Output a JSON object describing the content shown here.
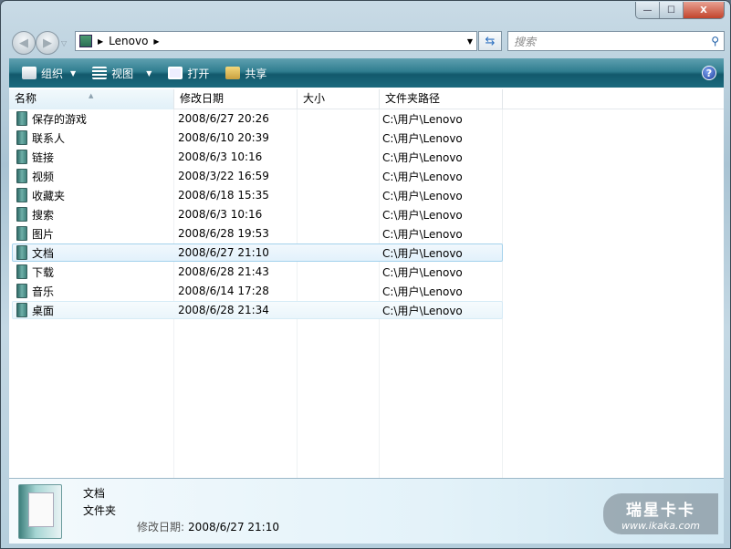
{
  "window": {
    "minimize": "—",
    "maximize": "☐",
    "close": "X"
  },
  "address": {
    "crumbs": [
      "Lenovo"
    ],
    "search_placeholder": "搜索"
  },
  "toolbar": {
    "organize": "组织",
    "views": "视图",
    "open": "打开",
    "share": "共享",
    "help": "?"
  },
  "columns": [
    "名称",
    "修改日期",
    "大小",
    "文件夹路径"
  ],
  "rows": [
    {
      "name": "保存的游戏",
      "date": "2008/6/27 20:26",
      "size": "",
      "path": "C:\\用户\\Lenovo",
      "icon": "saved-games-folder-icon"
    },
    {
      "name": "联系人",
      "date": "2008/6/10 20:39",
      "size": "",
      "path": "C:\\用户\\Lenovo",
      "icon": "contacts-folder-icon"
    },
    {
      "name": "链接",
      "date": "2008/6/3 10:16",
      "size": "",
      "path": "C:\\用户\\Lenovo",
      "icon": "links-folder-icon"
    },
    {
      "name": "视频",
      "date": "2008/3/22 16:59",
      "size": "",
      "path": "C:\\用户\\Lenovo",
      "icon": "videos-folder-icon"
    },
    {
      "name": "收藏夹",
      "date": "2008/6/18 15:35",
      "size": "",
      "path": "C:\\用户\\Lenovo",
      "icon": "favorites-folder-icon"
    },
    {
      "name": "搜索",
      "date": "2008/6/3 10:16",
      "size": "",
      "path": "C:\\用户\\Lenovo",
      "icon": "searches-folder-icon"
    },
    {
      "name": "图片",
      "date": "2008/6/28 19:53",
      "size": "",
      "path": "C:\\用户\\Lenovo",
      "icon": "pictures-folder-icon"
    },
    {
      "name": "文档",
      "date": "2008/6/27 21:10",
      "size": "",
      "path": "C:\\用户\\Lenovo",
      "icon": "documents-folder-icon",
      "state": "sel"
    },
    {
      "name": "下载",
      "date": "2008/6/28 21:43",
      "size": "",
      "path": "C:\\用户\\Lenovo",
      "icon": "downloads-folder-icon"
    },
    {
      "name": "音乐",
      "date": "2008/6/14 17:28",
      "size": "",
      "path": "C:\\用户\\Lenovo",
      "icon": "music-folder-icon"
    },
    {
      "name": "桌面",
      "date": "2008/6/28 21:34",
      "size": "",
      "path": "C:\\用户\\Lenovo",
      "icon": "desktop-folder-icon",
      "state": "hov"
    }
  ],
  "details": {
    "name": "文档",
    "type": "文件夹",
    "modified_label": "修改日期:",
    "modified_value": "2008/6/27 21:10"
  },
  "watermark": {
    "title": "瑞星卡卡",
    "url": "www.ikaka.com"
  },
  "colors": {
    "toolbar": "#1c6a7e",
    "selection": "#e2f1fb",
    "selection_border": "#a4d2ec"
  }
}
